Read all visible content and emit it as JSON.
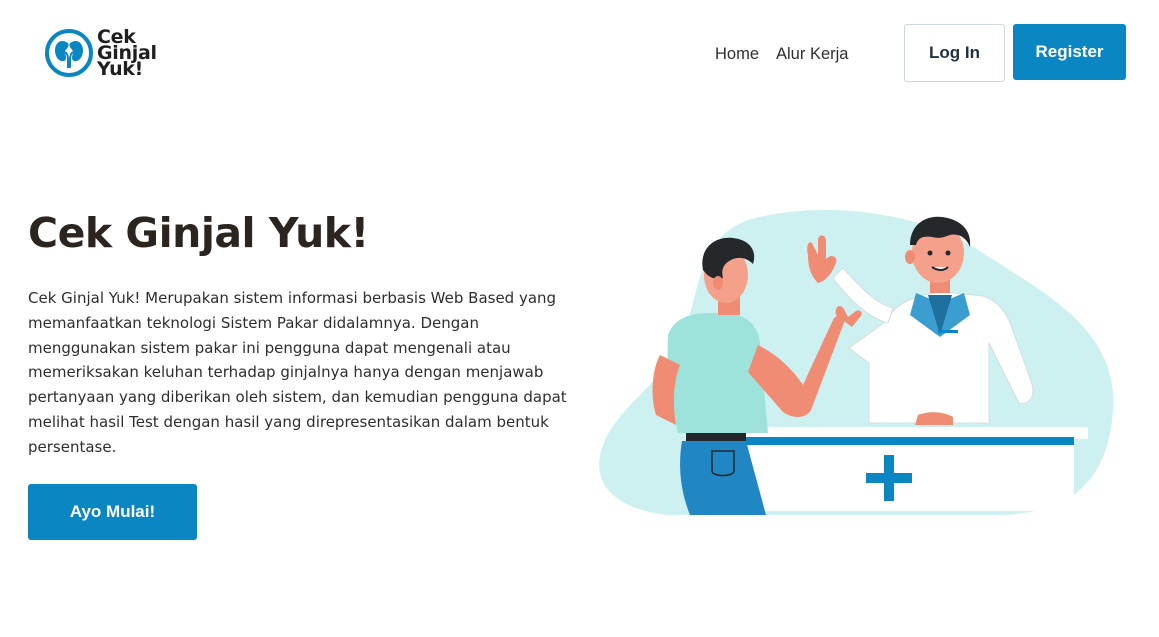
{
  "brand": {
    "name": "Cek Ginjal Yuk!",
    "logo_icon": "kidney-icon",
    "accent_color": "#0a87c2"
  },
  "nav": {
    "items": [
      {
        "label": "Home"
      },
      {
        "label": "Alur Kerja"
      }
    ]
  },
  "auth": {
    "login_label": "Log In",
    "register_label": "Register"
  },
  "hero": {
    "title": "Cek Ginjal Yuk!",
    "description": "Cek Ginjal Yuk! Merupakan sistem informasi berbasis Web Based yang memanfaatkan teknologi Sistem Pakar didalamnya. Dengan menggunakan sistem pakar ini pengguna dapat mengenali atau memeriksakan keluhan terhadap ginjalnya hanya dengan menjawab pertanyaan yang diberikan oleh sistem, dan kemudian pengguna dapat melihat hasil Test dengan hasil yang direpresentasikan dalam bentuk persentase.",
    "cta_label": "Ayo Mulai!",
    "illustration": "doctor-patient-illustration"
  }
}
